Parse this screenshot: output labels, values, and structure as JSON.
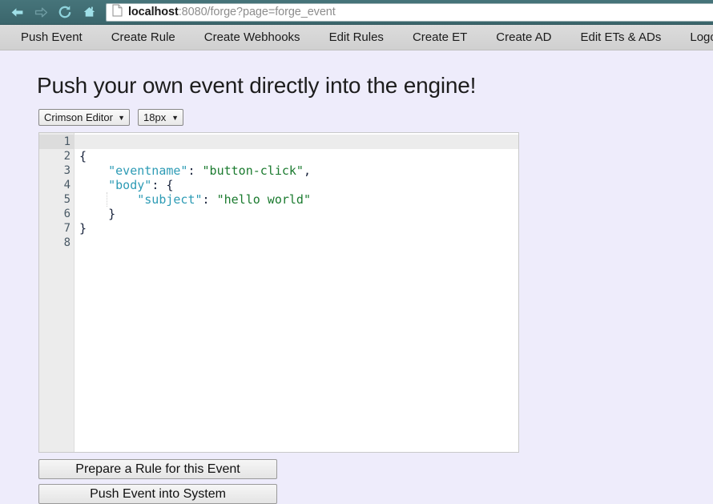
{
  "browser": {
    "back_icon": "back-arrow-icon",
    "forward_icon": "forward-arrow-icon",
    "reload_icon": "reload-icon",
    "home_icon": "home-icon",
    "page_icon": "page-document-icon",
    "url_host": "localhost",
    "url_rest": ":8080/forge?page=forge_event",
    "url_full": "localhost:8080/forge?page=forge_event",
    "toolbar_bg": "#3e6b71",
    "icon_color": "#8fd3dc"
  },
  "site_nav": {
    "items": [
      {
        "label": "Push Event"
      },
      {
        "label": "Create Rule"
      },
      {
        "label": "Create Webhooks"
      },
      {
        "label": "Edit Rules"
      },
      {
        "label": "Create ET"
      },
      {
        "label": "Create AD"
      },
      {
        "label": "Edit ETs & ADs"
      },
      {
        "label": "Logout"
      }
    ]
  },
  "page": {
    "title": "Push your own event directly into the engine!",
    "background": "#eeecfb"
  },
  "editor_toolbar": {
    "theme_select": {
      "value": "Crimson Editor",
      "options": [
        "Crimson Editor"
      ],
      "caret": "▼"
    },
    "fontsize_select": {
      "value": "18px",
      "options": [
        "18px"
      ],
      "caret": "▼"
    }
  },
  "editor": {
    "active_line": 1,
    "cursor_line": 1,
    "gutter": [
      {
        "num": "1",
        "fold": ""
      },
      {
        "num": "2",
        "fold": "▾"
      },
      {
        "num": "3",
        "fold": ""
      },
      {
        "num": "4",
        "fold": "▾"
      },
      {
        "num": "5",
        "fold": ""
      },
      {
        "num": "6",
        "fold": ""
      },
      {
        "num": "7",
        "fold": ""
      },
      {
        "num": "8",
        "fold": ""
      }
    ],
    "lines": [
      {
        "n": 1,
        "raw": ""
      },
      {
        "n": 2,
        "raw": "{"
      },
      {
        "n": 3,
        "raw": "    \"eventname\": \"button-click\","
      },
      {
        "n": 4,
        "raw": "    \"body\": {"
      },
      {
        "n": 5,
        "raw": "        \"subject\": \"hello world\""
      },
      {
        "n": 6,
        "raw": "    }"
      },
      {
        "n": 7,
        "raw": "}"
      },
      {
        "n": 8,
        "raw": ""
      }
    ],
    "content_text": "{\n    \"eventname\": \"button-click\",\n    \"body\": {\n        \"subject\": \"hello world\"\n    }\n}\n",
    "colors": {
      "key": "#2d9bb5",
      "string": "#1a7a2e",
      "punctuation": "#16213a",
      "active_line_bg": "#ececec",
      "gutter_bg": "#ececec"
    }
  },
  "buttons": {
    "prepare_rule": "Prepare a Rule for this Event",
    "push_event": "Push Event into System"
  }
}
